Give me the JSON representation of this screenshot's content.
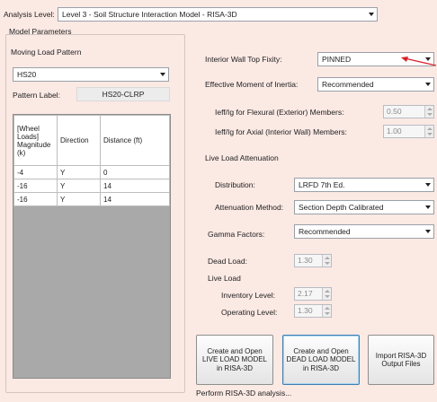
{
  "analysis_level": {
    "label": "Analysis Level:",
    "value": "Level 3 - Soil Structure Interaction Model - RISA-3D"
  },
  "model_parameters": {
    "title": "Model Parameters",
    "moving_load": {
      "title": "Moving Load Pattern",
      "pattern_value": "HS20",
      "pattern_label_caption": "Pattern Label:",
      "pattern_label_value": "HS20-CLRP",
      "table": {
        "headers": [
          "[Wheel Loads] Magnitude (k)",
          "Direction",
          "Distance (ft)"
        ],
        "rows": [
          [
            "-4",
            "Y",
            "0"
          ],
          [
            "-16",
            "Y",
            "14"
          ],
          [
            "-16",
            "Y",
            "14"
          ]
        ]
      }
    },
    "interior_wall_top_fixity": {
      "label": "Interior Wall Top Fixity:",
      "value": "PINNED"
    },
    "effective_moment_of_inertia": {
      "label": "Effective Moment of Inertia:",
      "value": "Recommended"
    },
    "ieff_flexural": {
      "label": "Ieff/Ig for Flexural (Exterior) Members:",
      "value": "0.50"
    },
    "ieff_axial": {
      "label": "Ieff/Ig for Axial (Interior Wall) Members:",
      "value": "1.00"
    },
    "live_load_attenuation": {
      "title": "Live Load Attenuation",
      "distribution": {
        "label": "Distribution:",
        "value": "LRFD 7th Ed."
      },
      "attenuation_method": {
        "label": "Attenuation Method:",
        "value": "Section Depth Calibrated"
      }
    },
    "gamma_factors": {
      "label": "Gamma Factors:",
      "value": "Recommended"
    },
    "dead_load": {
      "label": "Dead Load:",
      "value": "1.30"
    },
    "live_load": {
      "title": "Live Load",
      "inventory": {
        "label": "Inventory Level:",
        "value": "2.17"
      },
      "operating": {
        "label": "Operating Level:",
        "value": "1.30"
      }
    }
  },
  "buttons": {
    "live_load_model": "Create and Open LIVE LOAD MODEL in RISA-3D",
    "dead_load_model": "Create and Open DEAD LOAD MODEL in RISA-3D",
    "import_output": "Import RISA-3D Output Files"
  },
  "status": "Perform RISA-3D analysis...",
  "colors": {
    "background": "#fbe9e4",
    "annotation_arrow": "#d8202a"
  }
}
